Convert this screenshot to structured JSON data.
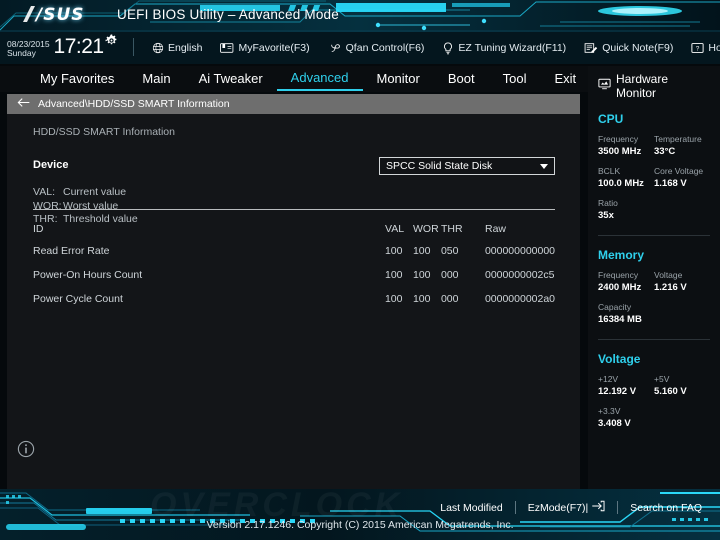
{
  "header": {
    "logo_text": "/SUS",
    "title": "UEFI BIOS Utility – Advanced Mode"
  },
  "toolbar": {
    "date": "08/23/2015",
    "weekday": "Sunday",
    "time": "17:21",
    "gear_icon": "gear-icon",
    "items": [
      {
        "label": "English",
        "icon": "globe-icon"
      },
      {
        "label": "MyFavorite(F3)",
        "icon": "bookmark-card-icon"
      },
      {
        "label": "Qfan Control(F6)",
        "icon": "fan-icon"
      },
      {
        "label": "EZ Tuning Wizard(F11)",
        "icon": "lightbulb-icon"
      },
      {
        "label": "Quick Note(F9)",
        "icon": "note-pencil-icon"
      },
      {
        "label": "Hot Keys",
        "icon": "question-key-icon"
      }
    ]
  },
  "tabs": [
    {
      "label": "My Favorites",
      "active": false
    },
    {
      "label": "Main",
      "active": false
    },
    {
      "label": "Ai Tweaker",
      "active": false
    },
    {
      "label": "Advanced",
      "active": true
    },
    {
      "label": "Monitor",
      "active": false
    },
    {
      "label": "Boot",
      "active": false
    },
    {
      "label": "Tool",
      "active": false
    },
    {
      "label": "Exit",
      "active": false
    }
  ],
  "breadcrumb": {
    "back_icon": "arrow-left-icon",
    "path": "Advanced\\HDD/SSD SMART Information"
  },
  "main": {
    "panel_title": "HDD/SSD SMART Information",
    "device_label": "Device",
    "device_value": "SPCC Solid State Disk",
    "legend": [
      {
        "key": "VAL:",
        "text": "Current value"
      },
      {
        "key": "WOR:",
        "text": "Worst value"
      },
      {
        "key": "THR:",
        "text": "Threshold value"
      }
    ],
    "table": {
      "columns": [
        "ID",
        "VAL",
        "WOR",
        "THR",
        "Raw"
      ],
      "rows": [
        {
          "id": "Read Error Rate",
          "val": "100",
          "wor": "100",
          "thr": "050",
          "raw": "000000000000"
        },
        {
          "id": "Power-On Hours Count",
          "val": "100",
          "wor": "100",
          "thr": "000",
          "raw": "0000000002c5"
        },
        {
          "id": "Power Cycle Count",
          "val": "100",
          "wor": "100",
          "thr": "000",
          "raw": "0000000002a0"
        }
      ]
    },
    "info_icon": "info-icon"
  },
  "sidebar": {
    "title": "Hardware Monitor",
    "title_icon": "monitor-icon",
    "sections": [
      {
        "name": "CPU",
        "pairs": [
          [
            {
              "key": "Frequency",
              "value": "3500 MHz"
            },
            {
              "key": "Temperature",
              "value": "33°C"
            }
          ],
          [
            {
              "key": "BCLK",
              "value": "100.0 MHz"
            },
            {
              "key": "Core Voltage",
              "value": "1.168 V"
            }
          ],
          [
            {
              "key": "Ratio",
              "value": "35x"
            }
          ]
        ]
      },
      {
        "name": "Memory",
        "pairs": [
          [
            {
              "key": "Frequency",
              "value": "2400 MHz"
            },
            {
              "key": "Voltage",
              "value": "1.216 V"
            }
          ],
          [
            {
              "key": "Capacity",
              "value": "16384 MB"
            }
          ]
        ]
      },
      {
        "name": "Voltage",
        "pairs": [
          [
            {
              "key": "+12V",
              "value": "12.192 V"
            },
            {
              "key": "+5V",
              "value": "5.160 V"
            }
          ],
          [
            {
              "key": "+3.3V",
              "value": "3.408 V"
            }
          ]
        ]
      }
    ]
  },
  "footer": {
    "links": [
      {
        "label": "Last Modified",
        "icon": ""
      },
      {
        "label": "EzMode(F7)|",
        "icon": "arrow-right-box-icon"
      },
      {
        "label": "Search on FAQ",
        "icon": ""
      }
    ],
    "version": "Version 2.17.1246. Copyright (C) 2015 American Megatrends, Inc.",
    "watermark": "OVERCLOCK"
  },
  "colors": {
    "accent": "#2fd0ec",
    "banner_dark": "#04161e",
    "panel_bg": "#131518",
    "crumb_bg": "#6e6e6e"
  }
}
